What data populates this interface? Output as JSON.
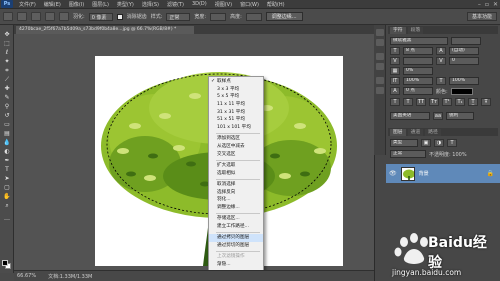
{
  "menubar": {
    "logo": "Ps",
    "items": [
      "文件(F)",
      "编辑(E)",
      "图像(I)",
      "图层(L)",
      "类型(Y)",
      "选择(S)",
      "滤镜(T)",
      "3D(D)",
      "视图(V)",
      "窗口(W)",
      "帮助(H)"
    ]
  },
  "options": {
    "feather_label": "羽化:",
    "feather_value": "0 像素",
    "antialias_label": "消除锯齿",
    "style_label": "样式:",
    "style_value": "正常",
    "width_label": "宽度:",
    "height_label": "高度:",
    "refine_button": "调整边缘...",
    "essentials": "基本功能"
  },
  "document": {
    "tab_title": "4270bcae_2f5f67a7b5d09a_s73bd9f0b4a8e...jpg @ 66.7%(RGB/8#) *"
  },
  "context_menu": {
    "items": [
      {
        "label": "取样点",
        "checked": true,
        "disabled": false,
        "highlight": false
      },
      {
        "label": "3 x 3 平均",
        "checked": false,
        "disabled": false,
        "highlight": false
      },
      {
        "label": "5 x 5 平均",
        "checked": false,
        "disabled": false,
        "highlight": false
      },
      {
        "label": "11 x 11 平均",
        "checked": false,
        "disabled": false,
        "highlight": false
      },
      {
        "label": "31 x 31 平均",
        "checked": false,
        "disabled": false,
        "highlight": false
      },
      {
        "label": "51 x 51 平均",
        "checked": false,
        "disabled": false,
        "highlight": false
      },
      {
        "label": "101 x 101 平均",
        "checked": false,
        "disabled": false,
        "highlight": false
      },
      {
        "sep": true
      },
      {
        "label": "添加到选区",
        "checked": false,
        "disabled": false,
        "highlight": false
      },
      {
        "label": "从选区中减去",
        "checked": false,
        "disabled": false,
        "highlight": false
      },
      {
        "label": "交叉选区",
        "checked": false,
        "disabled": false,
        "highlight": false
      },
      {
        "sep": true
      },
      {
        "label": "扩大选取",
        "checked": false,
        "disabled": false,
        "highlight": false
      },
      {
        "label": "选取相似",
        "checked": false,
        "disabled": false,
        "highlight": false
      },
      {
        "sep": true
      },
      {
        "label": "取消选择",
        "checked": false,
        "disabled": false,
        "highlight": false
      },
      {
        "label": "选择反向",
        "checked": false,
        "disabled": false,
        "highlight": false
      },
      {
        "label": "羽化...",
        "checked": false,
        "disabled": false,
        "highlight": false
      },
      {
        "label": "调整边缘...",
        "checked": false,
        "disabled": false,
        "highlight": false
      },
      {
        "sep": true
      },
      {
        "label": "存储选区...",
        "checked": false,
        "disabled": false,
        "highlight": false
      },
      {
        "label": "建立工作路径...",
        "checked": false,
        "disabled": false,
        "highlight": false
      },
      {
        "sep": true
      },
      {
        "label": "通过拷贝的图层",
        "checked": false,
        "disabled": false,
        "highlight": true
      },
      {
        "label": "通过剪切的图层",
        "checked": false,
        "disabled": false,
        "highlight": false
      },
      {
        "sep": true
      },
      {
        "label": "上次滤镜操作",
        "checked": false,
        "disabled": true,
        "highlight": false
      },
      {
        "label": "渐隐...",
        "checked": false,
        "disabled": false,
        "highlight": false
      }
    ]
  },
  "status": {
    "zoom": "66.67%",
    "doc_info": "文档:1.33M/1.33M"
  },
  "right_panels": {
    "char_tabs": [
      "字符",
      "段落"
    ],
    "adjust_tabs": [
      "调整",
      "样式"
    ],
    "font_field": "微软雅黑",
    "size_field": "8 点",
    "lead_field": "(自动)",
    "track_field": "0",
    "percent_field": "0%",
    "scale_v": "100%",
    "scale_h": "100%",
    "baseline": "0 点",
    "color_label": "颜色:",
    "lang": "美国英语",
    "aa": "锐利",
    "layer_tabs": [
      "图层",
      "通道",
      "路径"
    ],
    "kind_label": "类型",
    "mode_label": "正常",
    "opacity_label": "不透明度: 100%",
    "layer_name": "背景"
  },
  "watermark": {
    "brand": "Baidu经验",
    "url": "jingyan.baidu.com"
  }
}
